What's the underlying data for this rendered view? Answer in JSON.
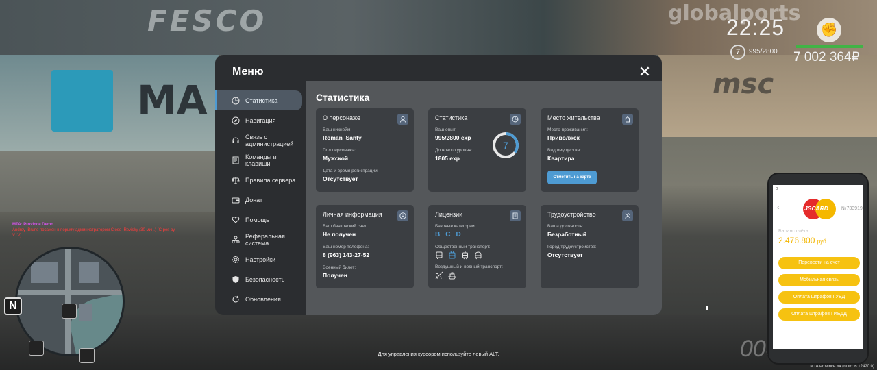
{
  "background": {
    "fesco_text": "FESCO",
    "globalports_text": "globalports",
    "maersk_text": "MA",
    "msc_text": "msc"
  },
  "hud": {
    "time": "22:25",
    "level": "7",
    "exp": "995/2800",
    "money": "7 002 364₽",
    "fist_icon": "fist-icon"
  },
  "chat": {
    "line1": "MTA: Province Demo",
    "line2": "Andrey_Bruno посажен в порьму администратором Close_Revisky (30 мин.) (C pes by V1V)"
  },
  "hint": "Для управления курсором используйте левый ALT.",
  "build": "MTA Province #4 (build: 6.12420.0)",
  "speed": "008",
  "menu": {
    "title": "Меню",
    "close_icon": "close-icon",
    "nav": [
      {
        "label": "Статистика",
        "icon": "pie-chart-icon"
      },
      {
        "label": "Навигация",
        "icon": "compass-icon"
      },
      {
        "label": "Связь с администрацией",
        "icon": "headset-icon"
      },
      {
        "label": "Команды и клавиши",
        "icon": "document-icon"
      },
      {
        "label": "Правила сервера",
        "icon": "scales-icon"
      },
      {
        "label": "Донат",
        "icon": "wallet-icon"
      },
      {
        "label": "Помощь",
        "icon": "heart-handshake-icon"
      },
      {
        "label": "Реферальная система",
        "icon": "referral-icon"
      },
      {
        "label": "Настройки",
        "icon": "gear-icon"
      },
      {
        "label": "Безопасность",
        "icon": "shield-icon"
      },
      {
        "label": "Обновления",
        "icon": "refresh-icon"
      }
    ],
    "active_index": 0,
    "content_title": "Статистика",
    "cards": {
      "character": {
        "title": "О персонаже",
        "icon": "user-icon",
        "nick_label": "Ваш никнейм:",
        "nick": "Roman_Santy",
        "gender_label": "Пол персонажа:",
        "gender": "Мужской",
        "reg_label": "Дата и время регистрации:",
        "reg": "Отсутствует"
      },
      "stats": {
        "title": "Статистика",
        "icon": "clock-pie-icon",
        "exp_label": "Ваш опыт:",
        "exp": "995/2800 exp",
        "next_label": "До нового уровня:",
        "next": "1805 exp",
        "level": "7",
        "progress": 0.355
      },
      "residence": {
        "title": "Место жительства",
        "icon": "house-icon",
        "place_label": "Место проживания:",
        "place": "Приволжск",
        "property_label": "Вид имущества:",
        "property": "Квартира",
        "map_button": "Отметить на карте"
      },
      "personal": {
        "title": "Личная информация",
        "icon": "user-circle-icon",
        "bank_label": "Ваш банковский счет:",
        "bank": "Не получен",
        "phone_label": "Ваш номер телефона:",
        "phone": "8 (963) 143-27-52",
        "military_label": "Военный билет:",
        "military": "Получен"
      },
      "licenses": {
        "title": "Лицензии",
        "icon": "document-license-icon",
        "basic_label": "Базовые категории:",
        "categories": [
          "B",
          "C",
          "D"
        ],
        "public_label": "Общественный транспорт:",
        "public_icons": [
          "bus-icon",
          "trolleybus-icon",
          "tram-icon",
          "train-icon"
        ],
        "public_active": [
          false,
          true,
          false,
          false
        ],
        "air_label": "Воздушный и водный транспорт:",
        "air_icons": [
          "plane-icon",
          "boat-icon"
        ]
      },
      "job": {
        "title": "Трудоустройство",
        "icon": "tools-icon",
        "position_label": "Ваша должность:",
        "position": "Безработный",
        "city_label": "Город трудоустройства:",
        "city": "Отсутствует"
      }
    }
  },
  "phone": {
    "status": "G",
    "brand": "JSCARD",
    "card_no": "№733919",
    "balance_label": "Баланс счёта:",
    "balance": "2.476.800",
    "currency": "руб.",
    "buttons": [
      "Перевести на счет",
      "Мобильная связь",
      "Оплата штрафов ГУВД",
      "Оплата штрафов ГИБДД"
    ]
  },
  "colors": {
    "accent": "#4e9bd3",
    "panel": "#2b2d30",
    "content": "#54575a",
    "card": "#3b3e42",
    "yellow": "#f6c211",
    "money_bar": "#41b346"
  }
}
